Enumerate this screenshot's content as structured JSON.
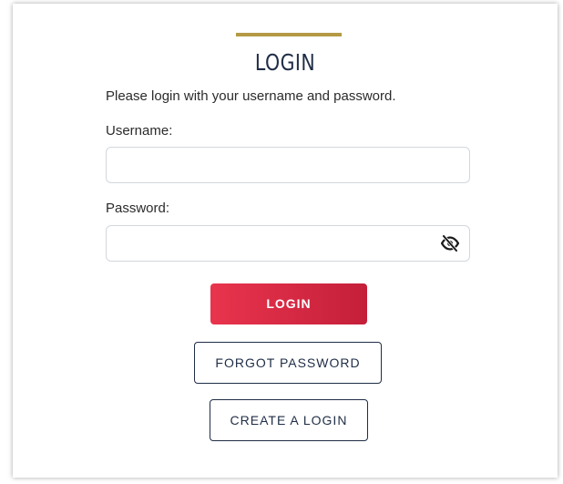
{
  "colors": {
    "accent_gold": "#b49a45",
    "login_red": "#d92a44",
    "navy_text": "#1f2d46"
  },
  "login": {
    "title": "LOGIN",
    "instructions": "Please login with your username and password.",
    "username_label": "Username:",
    "username_value": "",
    "password_label": "Password:",
    "password_value": "",
    "password_toggle_icon": "eye-slash-icon",
    "login_button": "LOGIN",
    "forgot_password_button": "FORGOT PASSWORD",
    "create_login_button": "CREATE A LOGIN"
  }
}
